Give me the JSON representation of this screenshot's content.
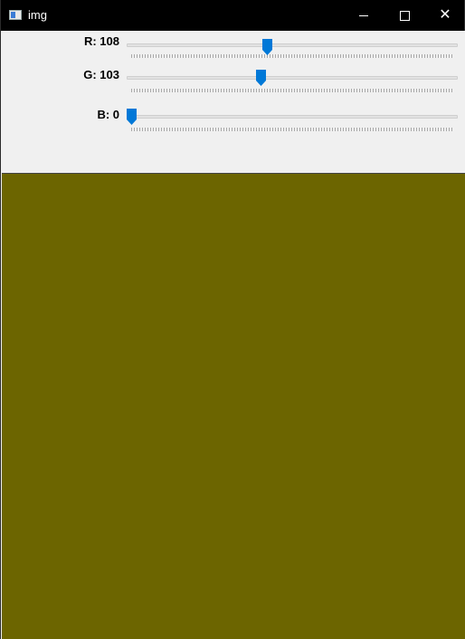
{
  "window": {
    "title": "img"
  },
  "titlebar": {
    "close_glyph": "✕"
  },
  "sliders": [
    {
      "label": "R: 108",
      "channel": "R",
      "value": 108,
      "max": 255
    },
    {
      "label": "G: 103",
      "channel": "G",
      "value": 103,
      "max": 255
    },
    {
      "label": "B: 0",
      "channel": "B",
      "value": 0,
      "max": 255
    }
  ],
  "colors": {
    "canvas": "#6c6500",
    "thumb": "#0078d7",
    "titlebar": "#000000"
  }
}
